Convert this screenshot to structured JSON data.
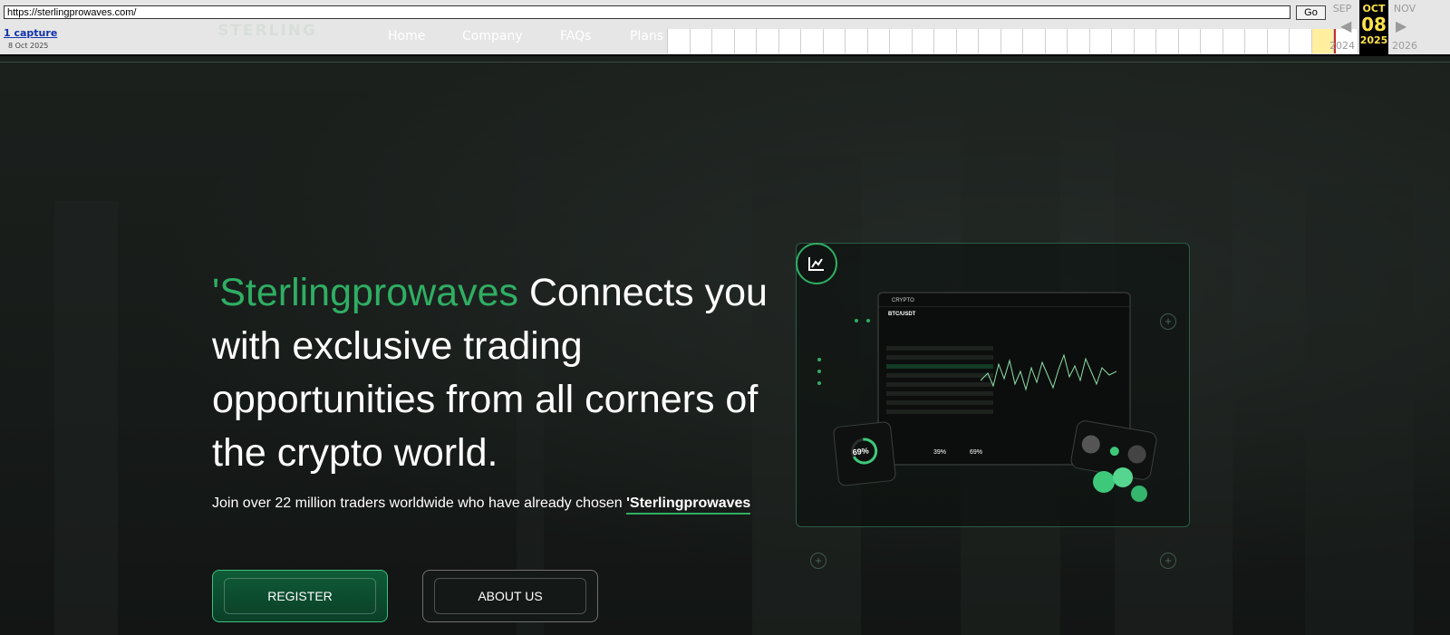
{
  "wayback": {
    "url": "https://sterlingprowaves.com/",
    "go_label": "Go",
    "captures_label": "1 capture",
    "capture_date": "8 Oct 2025",
    "prev_month": "SEP",
    "prev_year": "2024",
    "cur_month": "OCT",
    "cur_day": "08",
    "cur_year": "2025",
    "next_month": "NOV",
    "next_year": "2026"
  },
  "nav": {
    "logo_text": "STERLING",
    "items": [
      "Home",
      "Company",
      "FAQs",
      "Plans"
    ]
  },
  "hero": {
    "headline_brand": "'Sterlingprowaves",
    "headline_rest": " Connects you with exclusive trading opportunities from all corners of the crypto world.",
    "sub_text": "Join over 22 million traders worldwide who have already chosen ",
    "sub_brand": "'Sterlingprowaves",
    "register_label": "REGISTER",
    "about_label": "ABOUT US"
  },
  "dashboard": {
    "app_name": "CRYPTO",
    "pair": "BTC/USDT",
    "gauge_1": "69%",
    "gauge_2": "39%",
    "gauge_3": "69%"
  },
  "colors": {
    "accent": "#2fae63",
    "background": "#151917",
    "toolbar": "#e6e6e6"
  }
}
